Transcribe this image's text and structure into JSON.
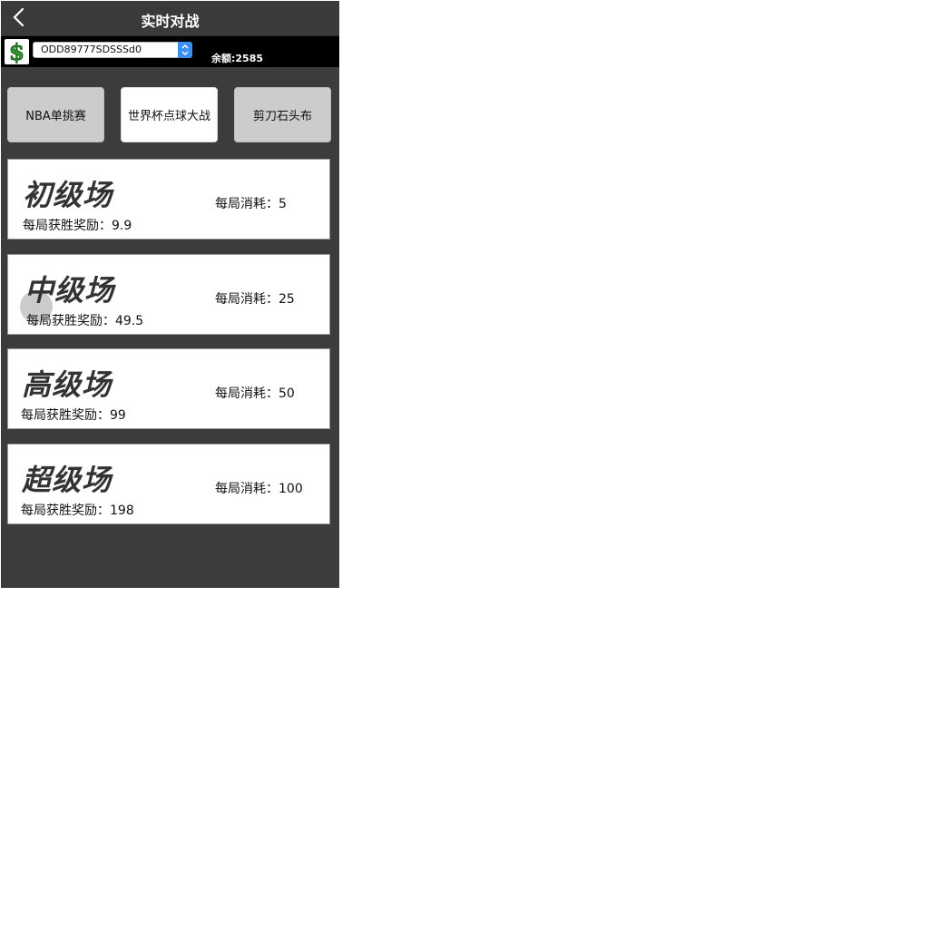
{
  "header": {
    "title": "实时对战"
  },
  "account_bar": {
    "coin_symbol": "$",
    "account_value": "ODD89777SDSSSd0",
    "balance": "余额:2585"
  },
  "tabs": [
    {
      "label": "NBA单挑赛",
      "active": false
    },
    {
      "label": "世界杯点球大战",
      "active": true
    },
    {
      "label": "剪刀石头布",
      "active": false
    }
  ],
  "levels": [
    {
      "title": "初级场",
      "cost": "每局消耗：5",
      "reward": "每局获胜奖励：9.9"
    },
    {
      "title": "中级场",
      "cost": "每局消耗：25",
      "reward": "每局获胜奖励：49.5"
    },
    {
      "title": "高级场",
      "cost": "每局消耗：50",
      "reward": "每局获胜奖励：99"
    },
    {
      "title": "超级场",
      "cost": "每局消耗：100",
      "reward": "每局获胜奖励：198"
    }
  ],
  "colors": {
    "dark_bg": "#3c3c3c",
    "select_accent": "#3a8ff0",
    "coin_green": "#2e9a2e"
  }
}
